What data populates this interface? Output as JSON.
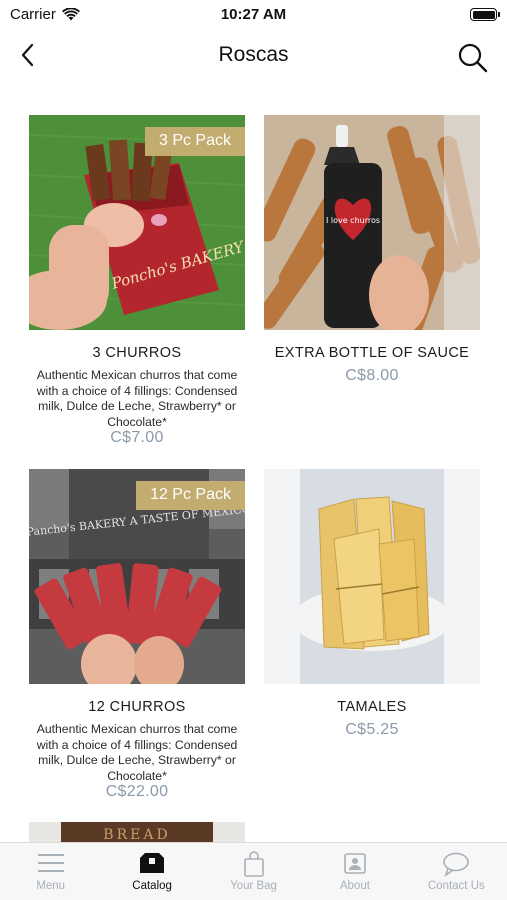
{
  "status_bar": {
    "carrier": "Carrier",
    "time": "10:27 AM"
  },
  "nav": {
    "title": "Roscas"
  },
  "products": [
    {
      "badge": "3 Pc Pack",
      "name": "3 CHURROS",
      "description": "Authentic Mexican churros that come with a choice of 4 fillings: Condensed milk, Dulce de Leche, Strawberry* or Chocolate*",
      "price": "C$7.00",
      "image_text": "Poncho's BAKERY"
    },
    {
      "name": "EXTRA BOTTLE OF SAUCE",
      "price": "C$8.00",
      "image_text": "I love churros"
    },
    {
      "badge": "12 Pc Pack",
      "name": "12 CHURROS",
      "description": "Authentic Mexican churros that come with a choice of 4 fillings: Condensed milk, Dulce de Leche, Strawberry* or Chocolate*",
      "price": "C$22.00",
      "image_text": "Pancho's BAKERY A TASTE OF MEXICO"
    },
    {
      "name": "TAMALES",
      "price": "C$5.25"
    },
    {
      "image_text": "BREAD"
    }
  ],
  "tabs": [
    {
      "label": "Menu",
      "icon": "menu-icon",
      "active": false
    },
    {
      "label": "Catalog",
      "icon": "catalog-icon",
      "active": true
    },
    {
      "label": "Your Bag",
      "icon": "bag-icon",
      "active": false
    },
    {
      "label": "About",
      "icon": "about-icon",
      "active": false
    },
    {
      "label": "Contact Us",
      "icon": "chat-icon",
      "active": false
    }
  ],
  "colors": {
    "badge": "#c2ac70",
    "price": "#8a9aab",
    "tab_inactive": "#a8b0b8",
    "tab_active": "#111111"
  }
}
